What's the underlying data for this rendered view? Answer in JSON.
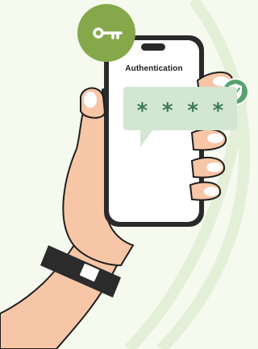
{
  "screen": {
    "title": "Authentication"
  },
  "pin": {
    "chars": [
      "*",
      "*",
      "*",
      "*"
    ]
  },
  "icons": {
    "key": "key-icon",
    "shield": "shield-check-icon"
  },
  "colors": {
    "background": "#f5f9ee",
    "accent_green": "#86a84a",
    "bubble": "#d3e6d2",
    "pin_text": "#3d7a5c",
    "shield_green": "#58a26e",
    "skin": "#f7c6a6",
    "skin_outline": "#1f1f1f",
    "phone_frame": "#2a2a2a",
    "strap": "#2b2b2b"
  }
}
